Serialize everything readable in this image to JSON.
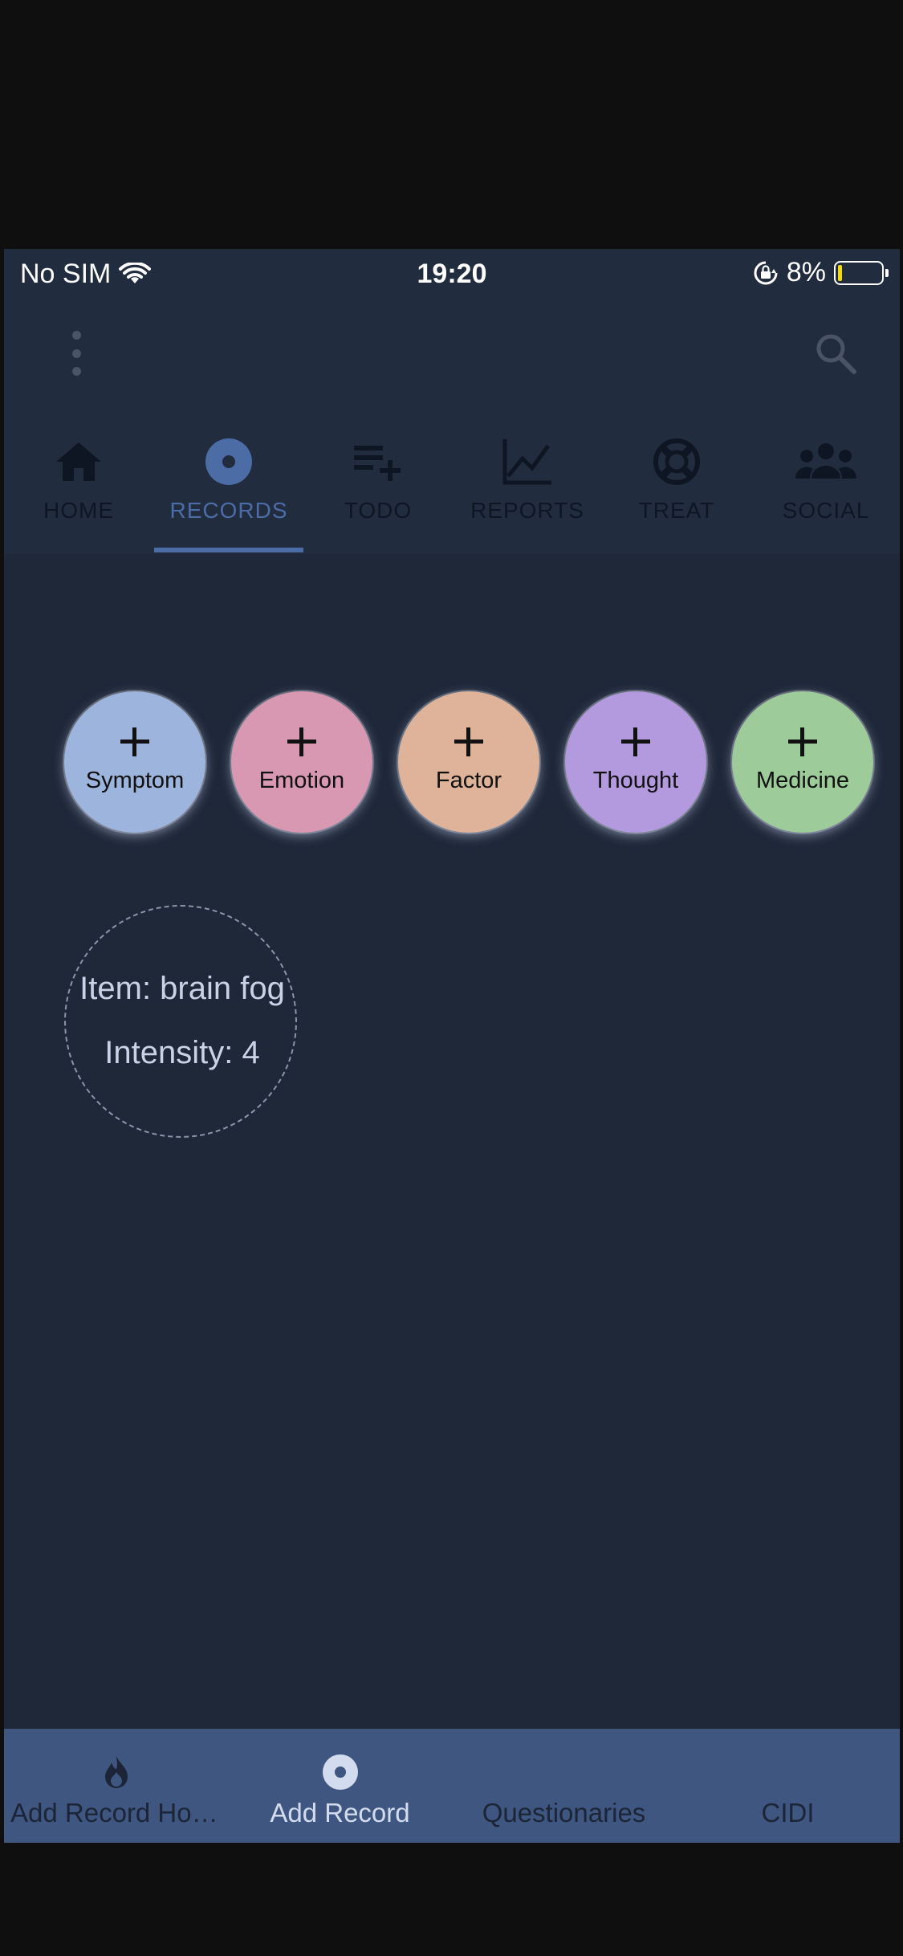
{
  "status_bar": {
    "carrier": "No SIM",
    "time": "19:20",
    "battery": "8%"
  },
  "tabs": [
    {
      "label": "HOME",
      "icon": "home-icon",
      "active": false
    },
    {
      "label": "RECORDS",
      "icon": "records-icon",
      "active": true
    },
    {
      "label": "TODO",
      "icon": "playlist-add-icon",
      "active": false
    },
    {
      "label": "REPORTS",
      "icon": "chart-line-icon",
      "active": false
    },
    {
      "label": "TREAT",
      "icon": "lifebuoy-icon",
      "active": false
    },
    {
      "label": "SOCIAL",
      "icon": "group-icon",
      "active": false
    }
  ],
  "add_buttons": [
    {
      "label": "Symptom",
      "color": "#9db5dc"
    },
    {
      "label": "Emotion",
      "color": "#d998b1"
    },
    {
      "label": "Factor",
      "color": "#dfb39a"
    },
    {
      "label": "Thought",
      "color": "#b39ade"
    },
    {
      "label": "Medicine",
      "color": "#9dcb9a"
    }
  ],
  "record": {
    "item": "Item: brain fog",
    "intensity": "Intensity: 4"
  },
  "bottom_nav": [
    {
      "label": "Add Record Home",
      "icon": "fire-icon",
      "active": false
    },
    {
      "label": "Add Record",
      "icon": "record-icon",
      "active": true
    },
    {
      "label": "Questionaries",
      "icon": "",
      "active": false
    },
    {
      "label": "CIDI",
      "icon": "",
      "active": false
    }
  ],
  "colors": {
    "active_accent": "#4c6ca6",
    "bottom_bar": "#3f5680",
    "background": "#1f2839"
  }
}
